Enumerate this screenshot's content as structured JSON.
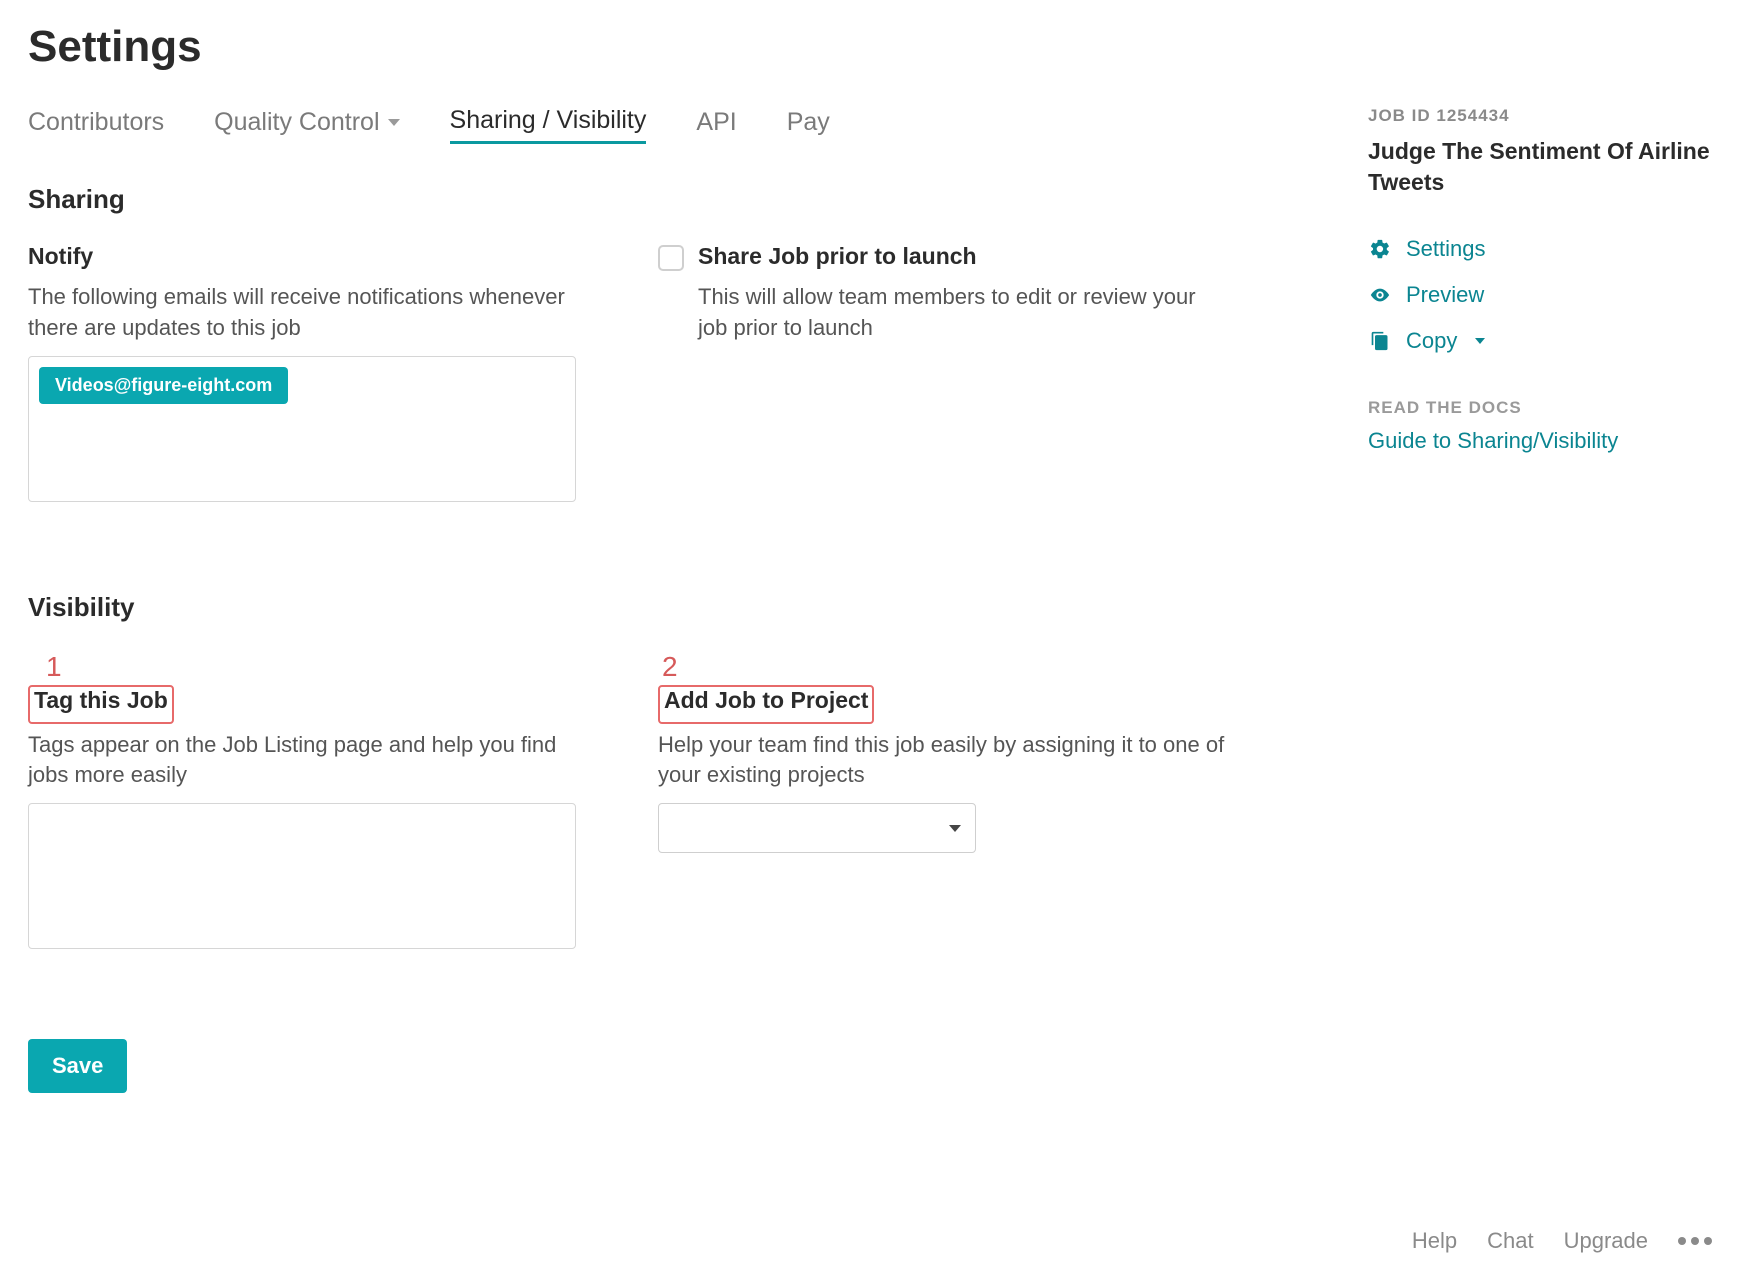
{
  "page": {
    "title": "Settings"
  },
  "tabs": {
    "contributors": "Contributors",
    "quality": "Quality Control",
    "sharing": "Sharing / Visibility",
    "api": "API",
    "pay": "Pay"
  },
  "sharing": {
    "heading": "Sharing",
    "notify": {
      "title": "Notify",
      "desc": "The following emails will receive notifications whenever there are updates to this job",
      "emails": [
        "Videos@figure-eight.com"
      ]
    },
    "share_prior": {
      "title": "Share Job prior to launch",
      "desc": "This will allow team members to edit or review your job prior to launch",
      "checked": false
    }
  },
  "visibility": {
    "heading": "Visibility",
    "callouts": {
      "one": "1",
      "two": "2"
    },
    "tag": {
      "title": "Tag this Job",
      "desc": "Tags appear on the Job Listing page and help you find jobs more easily"
    },
    "project": {
      "title": "Add Job to Project",
      "desc": "Help your team find this job easily by assigning it to one of your existing projects",
      "selected": ""
    }
  },
  "actions": {
    "save": "Save"
  },
  "sidebar": {
    "job_id_label": "JOB ID 1254434",
    "job_title": "Judge The Sentiment Of Airline Tweets",
    "links": {
      "settings": "Settings",
      "preview": "Preview",
      "copy": "Copy"
    },
    "docs_heading": "READ THE DOCS",
    "docs_link": "Guide to Sharing/Visibility"
  },
  "footer": {
    "help": "Help",
    "chat": "Chat",
    "upgrade": "Upgrade"
  }
}
